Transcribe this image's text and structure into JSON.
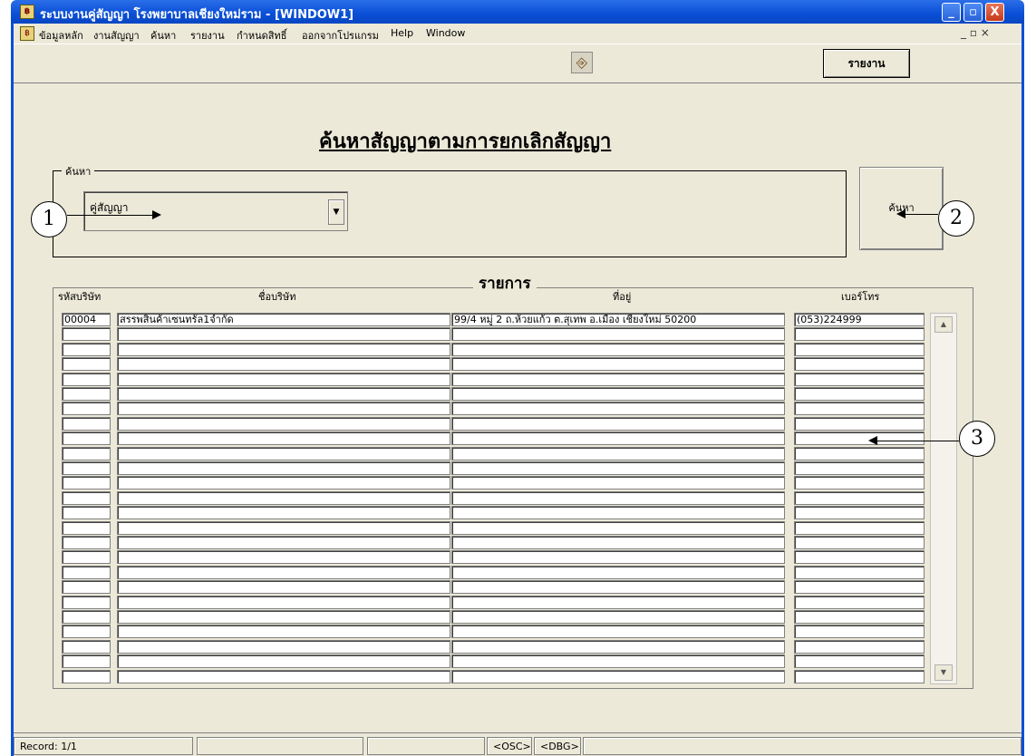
{
  "window": {
    "title": "ระบบงานคู่สัญญา โรงพยาบาลเชียงใหม่ราม - [WINDOW1]",
    "min_glyph": "_",
    "max_glyph": "▫",
    "close_glyph": "X"
  },
  "menu": {
    "items": [
      "ข้อมูลหลัก",
      "งานสัญญา",
      "ค้นหา",
      "รายงาน",
      "กำหนดสิทธิ์",
      "ออกจากโปรแกรม",
      "Help",
      "Window"
    ],
    "mdi_controls": "_  ▫  ×"
  },
  "toolbar": {
    "exit_icon": "door-exit-icon",
    "report_label": "รายงาน"
  },
  "page": {
    "title": "ค้นหาสัญญาตามการยกเลิกสัญญา"
  },
  "search": {
    "legend": "ค้นหา",
    "combo_value": "คู่สัญญา",
    "button_label": "ค้นหา"
  },
  "list": {
    "legend": "รายการ",
    "headers": [
      "รหัสบริษัท",
      "ชื่อบริษัท",
      "ที่อยู่",
      "เบอร์โทร"
    ],
    "rows": [
      [
        "00004",
        "สรรพสินค้าเซนทรัล1จำกัด",
        "99/4 หมู่ 2 ถ.ห้วยแก้ว ต.สุเทพ อ.เมือง เชียงใหม่ 50200",
        "(053)224999"
      ],
      [
        "",
        "",
        "",
        ""
      ],
      [
        "",
        "",
        "",
        ""
      ],
      [
        "",
        "",
        "",
        ""
      ],
      [
        "",
        "",
        "",
        ""
      ],
      [
        "",
        "",
        "",
        ""
      ],
      [
        "",
        "",
        "",
        ""
      ],
      [
        "",
        "",
        "",
        ""
      ],
      [
        "",
        "",
        "",
        ""
      ],
      [
        "",
        "",
        "",
        ""
      ],
      [
        "",
        "",
        "",
        ""
      ],
      [
        "",
        "",
        "",
        ""
      ],
      [
        "",
        "",
        "",
        ""
      ],
      [
        "",
        "",
        "",
        ""
      ],
      [
        "",
        "",
        "",
        ""
      ],
      [
        "",
        "",
        "",
        ""
      ],
      [
        "",
        "",
        "",
        ""
      ],
      [
        "",
        "",
        "",
        ""
      ],
      [
        "",
        "",
        "",
        ""
      ],
      [
        "",
        "",
        "",
        ""
      ],
      [
        "",
        "",
        "",
        ""
      ],
      [
        "",
        "",
        "",
        ""
      ],
      [
        "",
        "",
        "",
        ""
      ],
      [
        "",
        "",
        "",
        ""
      ],
      [
        "",
        "",
        "",
        ""
      ]
    ]
  },
  "callouts": [
    "1",
    "2",
    "3"
  ],
  "status": {
    "record": "Record: 1/1",
    "osc": "<OSC>",
    "dbg": "<DBG>"
  }
}
